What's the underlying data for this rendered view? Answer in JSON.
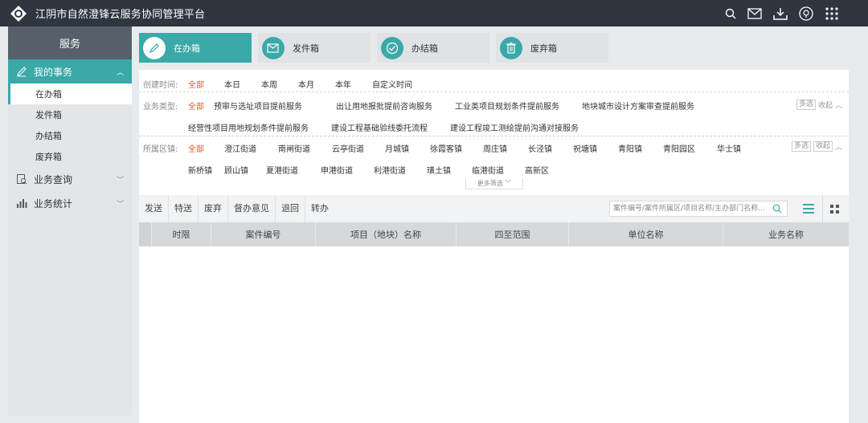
{
  "app": {
    "title": "江阴市自然澄锋云服务协同管理平台"
  },
  "topbar": {
    "icons": [
      "search-icon",
      "mail-icon",
      "download-icon",
      "user-icon",
      "apps-grid-icon"
    ]
  },
  "sidebar": {
    "header": "服务",
    "groups": [
      {
        "label": "我的事务",
        "icon": "pen-icon",
        "expanded": true,
        "items": [
          {
            "label": "在办箱",
            "active": true
          },
          {
            "label": "发件箱"
          },
          {
            "label": "办结箱"
          },
          {
            "label": "废弃箱"
          }
        ]
      },
      {
        "label": "业务查询",
        "icon": "search-doc-icon",
        "expanded": false
      },
      {
        "label": "业务统计",
        "icon": "bar-chart-icon",
        "expanded": false
      }
    ]
  },
  "tabs": [
    {
      "label": "在办箱",
      "icon": "pen-icon",
      "active": true
    },
    {
      "label": "发件箱",
      "icon": "send-mail-icon"
    },
    {
      "label": "办结箱",
      "icon": "check-icon"
    },
    {
      "label": "废弃箱",
      "icon": "trash-icon"
    }
  ],
  "filters": {
    "created": {
      "label": "创建时间:",
      "options": [
        "全部",
        "本日",
        "本周",
        "本月",
        "本年",
        "自定义时间"
      ],
      "selected": "全部"
    },
    "biz_type": {
      "label": "业务类型:",
      "options": [
        "全部",
        "预审与选址项目提前服务",
        "出让用地报批提前咨询服务",
        "工业类项目规划条件提前服务",
        "地块城市设计方案审查提前服务"
      ],
      "options_row2": [
        "经营性项目用地规划条件提前服务",
        "建设工程基础验线委托流程",
        "建设工程竣工测绘提前沟通对接服务"
      ],
      "selected": "全部",
      "multi": "多选",
      "collapse": "收起"
    },
    "district": {
      "label": "所属区镇:",
      "options": [
        "全部",
        "澄江街道",
        "南闸街道",
        "云亭街道",
        "月城镇",
        "徐霞客镇",
        "周庄镇",
        "长泾镇",
        "祝塘镇",
        "青阳镇",
        "青阳园区",
        "华士镇"
      ],
      "options_row2": [
        "新桥镇",
        "顾山镇",
        "夏港街道",
        "申港街道",
        "利港街道",
        "璜土镇",
        "临港街道",
        "高新区"
      ],
      "selected": "全部",
      "multi": "多选",
      "collapse": "收起"
    },
    "more": "更多筛选"
  },
  "toolbar": {
    "buttons": [
      "发送",
      "特送",
      "废弃",
      "督办意见",
      "退回",
      "转办"
    ],
    "search_placeholder": "案件编号/案件所属区/项目名称/主办部门名称..."
  },
  "table": {
    "columns": [
      "时限",
      "案件编号",
      "项目（地块）名称",
      "四至范围",
      "单位名称",
      "业务名称"
    ]
  },
  "colors": {
    "accent": "#3aa9a8",
    "selected_filter": "#e2572c",
    "topbar": "#2f3640"
  }
}
